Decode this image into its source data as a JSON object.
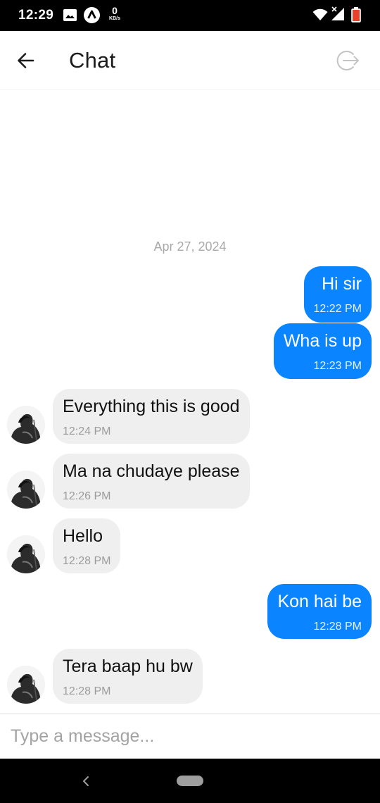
{
  "status_bar": {
    "time": "12:29",
    "net_speed_value": "0",
    "net_speed_unit": "KB/s",
    "battery_level": "82",
    "icons": [
      "image-icon",
      "arrow-app-icon",
      "wifi-icon",
      "signal-icon",
      "battery-icon"
    ]
  },
  "header": {
    "title": "Chat",
    "back_icon": "arrow-left-icon",
    "logout_icon": "logout-icon"
  },
  "conversation": {
    "date_label": "Apr 27, 2024",
    "messages": [
      {
        "direction": "outgoing",
        "text": "Hi sir",
        "time": "12:22 PM"
      },
      {
        "direction": "outgoing",
        "text": "Wha is up",
        "time": "12:23 PM"
      },
      {
        "direction": "incoming",
        "text": "Everything this is good",
        "time": "12:24 PM"
      },
      {
        "direction": "incoming",
        "text": "Ma na chudaye please",
        "time": "12:26 PM"
      },
      {
        "direction": "incoming",
        "text": "Hello",
        "time": "12:28 PM"
      },
      {
        "direction": "outgoing",
        "text": "Kon hai be",
        "time": "12:28 PM"
      },
      {
        "direction": "incoming",
        "text": "Tera baap hu bw",
        "time": "12:28 PM"
      }
    ]
  },
  "composer": {
    "placeholder": "Type a message...",
    "value": ""
  },
  "colors": {
    "outgoing_bubble": "#0a84ff",
    "incoming_bubble": "#efefef",
    "status_bar": "#000000"
  }
}
